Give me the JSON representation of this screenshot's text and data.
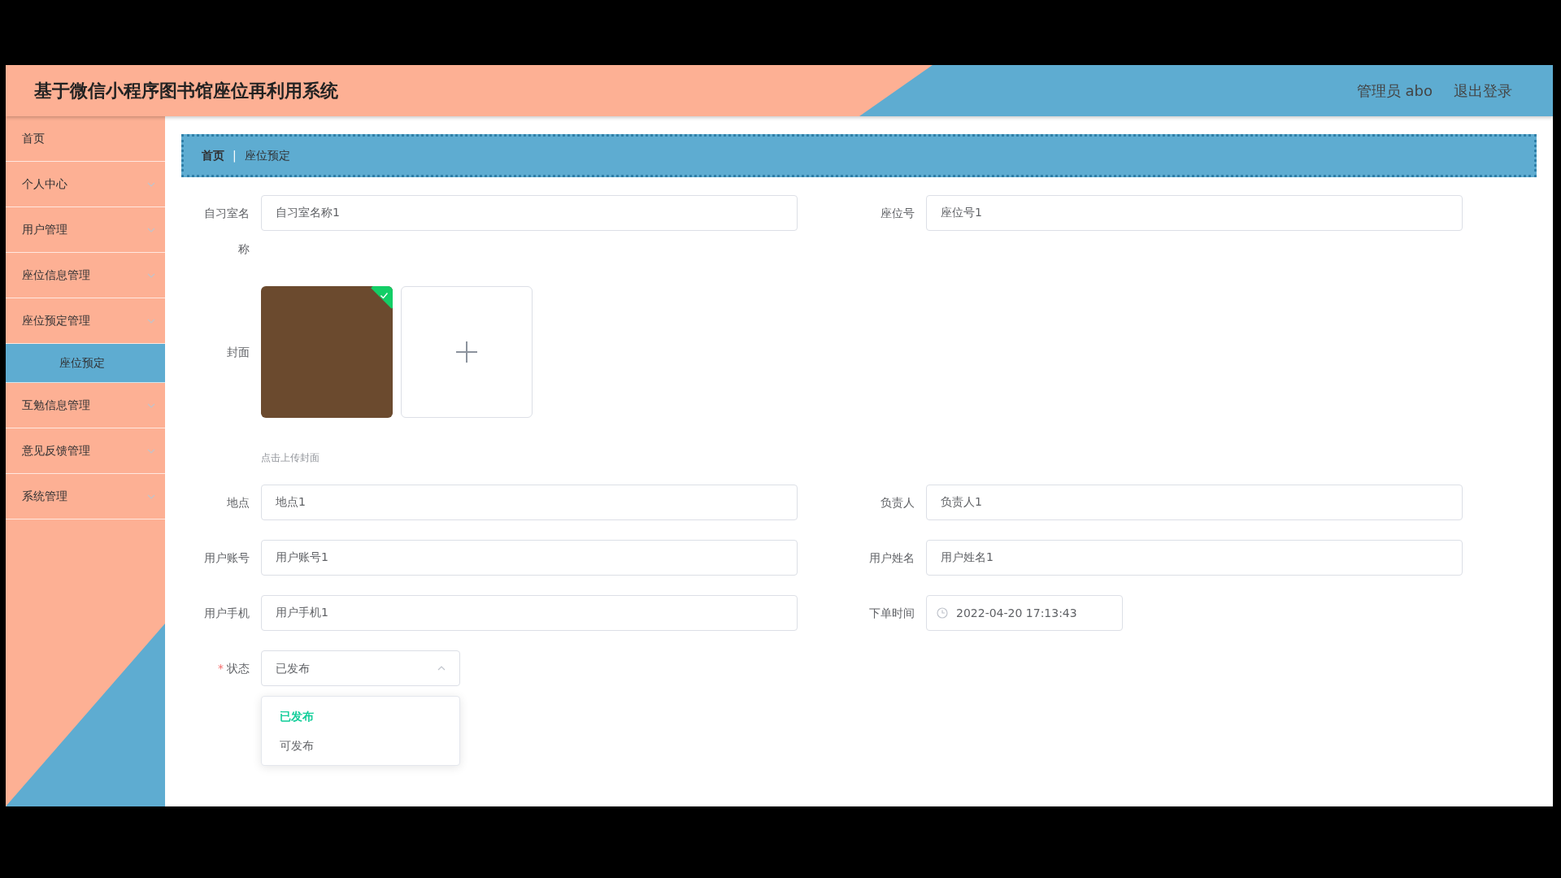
{
  "header": {
    "title": "基于微信小程序图书馆座位再利用系统",
    "user": "管理员 abo",
    "logout": "退出登录"
  },
  "sidebar": {
    "items": [
      {
        "label": "首页",
        "kind": "link"
      },
      {
        "label": "个人中心",
        "kind": "submenu"
      },
      {
        "label": "用户管理",
        "kind": "submenu"
      },
      {
        "label": "座位信息管理",
        "kind": "submenu"
      },
      {
        "label": "座位预定管理",
        "kind": "submenu",
        "children": [
          {
            "label": "座位预定",
            "selected": true
          }
        ]
      },
      {
        "label": "互勉信息管理",
        "kind": "submenu"
      },
      {
        "label": "意见反馈管理",
        "kind": "submenu"
      },
      {
        "label": "系统管理",
        "kind": "submenu"
      }
    ]
  },
  "breadcrumb": {
    "separator": "|",
    "items": [
      "首页",
      "座位预定"
    ]
  },
  "form": {
    "rows": [
      [
        {
          "kind": "text",
          "label": "自习室名称",
          "value": "自习室名称1"
        },
        {
          "kind": "text",
          "label": "座位号",
          "value": "座位号1"
        }
      ],
      [
        {
          "kind": "image",
          "label": "封面",
          "uploaded": true,
          "hint": "点击上传封面"
        }
      ],
      [
        {
          "kind": "text",
          "label": "地点",
          "value": "地点1"
        },
        {
          "kind": "text",
          "label": "负责人",
          "value": "负责人1"
        }
      ],
      [
        {
          "kind": "text",
          "label": "用户账号",
          "value": "用户账号1"
        },
        {
          "kind": "text",
          "label": "用户姓名",
          "value": "用户姓名1"
        }
      ],
      [
        {
          "kind": "text",
          "label": "用户手机",
          "value": "用户手机1"
        },
        {
          "kind": "datetime",
          "label": "下单时间",
          "value": "2022-04-20 17:13:43"
        }
      ],
      [
        {
          "kind": "select",
          "label": "状态",
          "required_mark": "*",
          "value": "已发布",
          "open": true,
          "options": [
            {
              "label": "已发布",
              "selected": true
            },
            {
              "label": "可发布",
              "selected": false
            }
          ]
        }
      ]
    ]
  }
}
